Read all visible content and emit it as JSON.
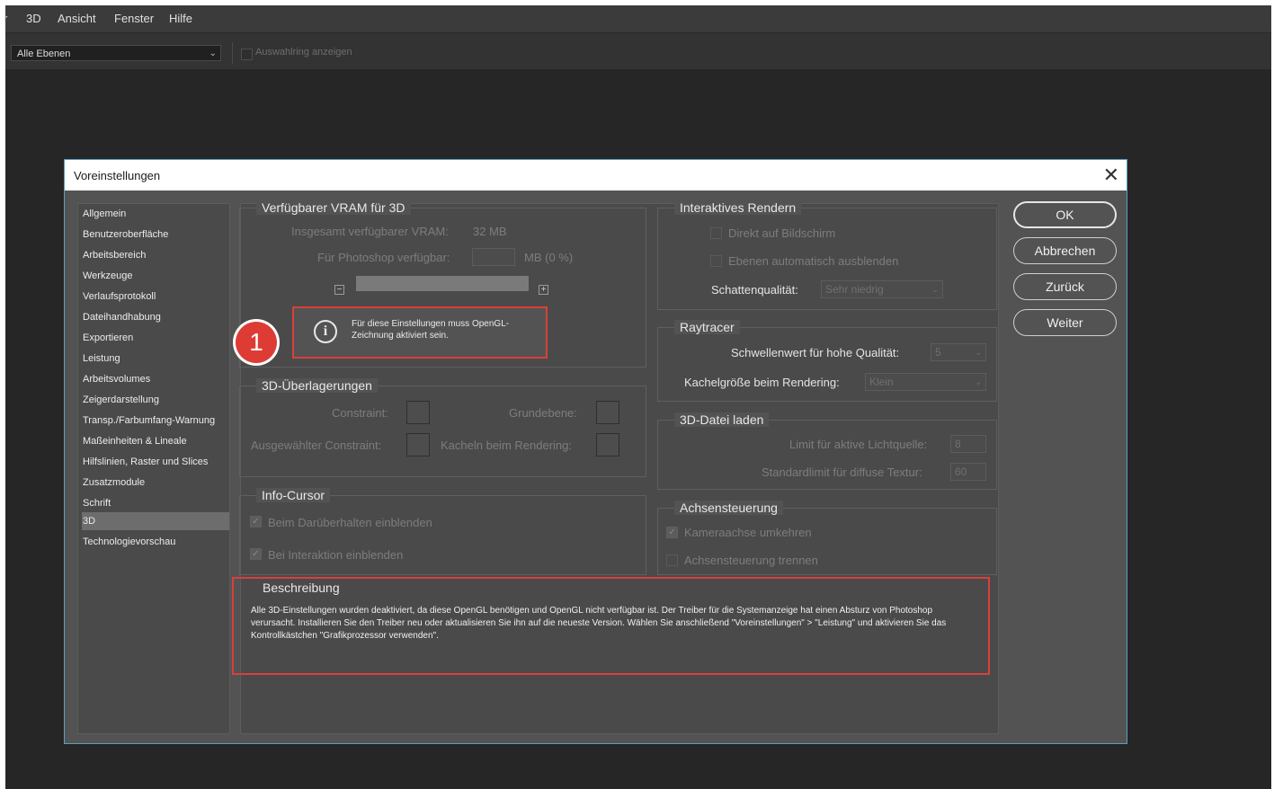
{
  "menubar": [
    "r",
    "3D",
    "Ansicht",
    "Fenster",
    "Hilfe"
  ],
  "options": {
    "layer_select": "Alle Ebenen",
    "show_ring_label": "Auswahlring anzeigen"
  },
  "dialog": {
    "title": "Voreinstellungen",
    "sidebar": [
      "Allgemein",
      "Benutzeroberfläche",
      "Arbeitsbereich",
      "Werkzeuge",
      "Verlaufsprotokoll",
      "Dateihandhabung",
      "Exportieren",
      "Leistung",
      "Arbeitsvolumes",
      "Zeigerdarstellung",
      "Transp./Farbumfang-Warnung",
      "Maßeinheiten & Lineale",
      "Hilfslinien, Raster und Slices",
      "Zusatzmodule",
      "Schrift",
      "3D",
      "Technologievorschau"
    ],
    "selected": "3D",
    "vram": {
      "title": "Verfügbarer VRAM für 3D",
      "total_label": "Insgesamt verfügbarer VRAM:",
      "total_value": "32 MB",
      "available_label": "Für Photoshop verfügbar:",
      "available_unit": "MB (0 %)",
      "minus": "−",
      "plus": "+",
      "warning": "Für diese Einstellungen muss OpenGL-Zeichnung aktiviert sein.",
      "info_glyph": "i",
      "badge": "1"
    },
    "overlays": {
      "title": "3D-Überlagerungen",
      "constraint": "Constraint:",
      "ground": "Grundebene:",
      "selected_constraint": "Ausgewählter Constraint:",
      "tiles": "Kacheln beim Rendering:"
    },
    "cursor": {
      "title": "Info-Cursor",
      "hover": "Beim Darüberhalten einblenden",
      "interaction": "Bei Interaktion einblenden",
      "check": "✓"
    },
    "render": {
      "title": "Interaktives Rendern",
      "direct": "Direkt auf Bildschirm",
      "autohide": "Ebenen automatisch ausblenden",
      "shadow_label": "Schattenqualität:",
      "shadow_value": "Sehr niedrig"
    },
    "raytracer": {
      "title": "Raytracer",
      "threshold_label": "Schwellenwert für hohe Qualität:",
      "threshold_value": "5",
      "tile_label": "Kachelgröße beim Rendering:",
      "tile_value": "Klein"
    },
    "fileload": {
      "title": "3D-Datei laden",
      "light_label": "Limit für aktive Lichtquelle:",
      "light_value": "8",
      "texture_label": "Standardlimit für diffuse Textur:",
      "texture_value": "60"
    },
    "axis": {
      "title": "Achsensteuerung",
      "invert": "Kameraachse umkehren",
      "separate": "Achsensteuerung trennen"
    },
    "description": {
      "title": "Beschreibung",
      "text": "Alle 3D-Einstellungen wurden deaktiviert, da diese OpenGL benötigen und OpenGL nicht verfügbar ist. Der Treiber für die Systemanzeige hat einen Absturz von Photoshop verursacht. Installieren Sie den Treiber neu oder aktualisieren Sie ihn auf die neueste Version. Wählen Sie anschließend \"Voreinstellungen\" > \"Leistung\" und aktivieren Sie das Kontrollkästchen \"Grafikprozessor verwenden\"."
    },
    "buttons": {
      "ok": "OK",
      "cancel": "Abbrechen",
      "back": "Zurück",
      "next": "Weiter"
    },
    "close": "✕"
  }
}
